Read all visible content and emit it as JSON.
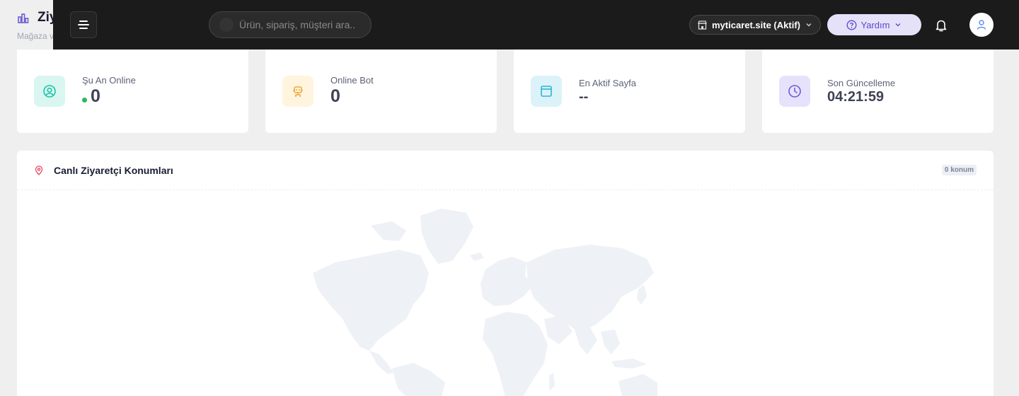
{
  "page": {
    "title": "Ziy",
    "subtitle": "Mağaza v"
  },
  "topbar": {
    "search_placeholder": "Ürün, sipariş, müşteri ara..",
    "store_label": "myticaret.site (Aktif)",
    "help_label": "Yardım"
  },
  "stats": [
    {
      "label": "Şu An Online",
      "value": "0",
      "icon": "user-circle-icon",
      "color": "#1bc5a8"
    },
    {
      "label": "Online Bot",
      "value": "0",
      "icon": "robot-icon",
      "color": "#f1a83c"
    },
    {
      "label": "En Aktif Sayfa",
      "value": "--",
      "icon": "browser-window-icon",
      "color": "#2cb6d3"
    },
    {
      "label": "Son Güncelleme",
      "value": "04:21:59",
      "icon": "clock-icon",
      "color": "#6c5dd3"
    }
  ],
  "map_panel": {
    "title": "Canlı Ziyaretçi Konumları",
    "badge": "0 konum"
  }
}
